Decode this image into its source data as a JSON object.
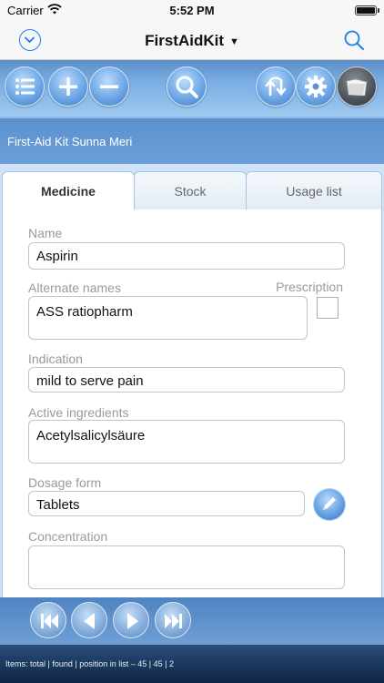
{
  "status_bar": {
    "carrier": "Carrier",
    "time": "5:52 PM"
  },
  "nav": {
    "title": "FirstAidKit",
    "caret": "▼"
  },
  "header": {
    "kit_name": "First-Aid Kit  Sunna Meri"
  },
  "tabs": [
    {
      "label": "Medicine",
      "active": true
    },
    {
      "label": "Stock",
      "active": false
    },
    {
      "label": "Usage list",
      "active": false
    }
  ],
  "form": {
    "name": {
      "label": "Name",
      "value": "Aspirin"
    },
    "alternate_names": {
      "label": "Alternate names",
      "value": "ASS ratiopharm"
    },
    "prescription": {
      "label": "Prescription",
      "checked": false
    },
    "indication": {
      "label": "Indication",
      "value": "mild to serve pain"
    },
    "active_ingredients": {
      "label": "Active ingredients",
      "value": "Acetylsalicylsäure"
    },
    "dosage_form": {
      "label": "Dosage form",
      "value": "Tablets"
    },
    "concentration": {
      "label": "Concentration",
      "value": ""
    }
  },
  "footer": {
    "text": "Items: total | found | position in list  –  45 | 45 | 2"
  },
  "icons": {
    "nav_left": "chevron-down-circle-icon",
    "nav_right": "search-icon",
    "toolbar": [
      "list-icon",
      "plus-icon",
      "minus-icon",
      "search-icon",
      "sort-icon",
      "gear-icon",
      "folder-icon"
    ],
    "bottom": [
      "first-record-icon",
      "previous-record-icon",
      "next-record-icon",
      "last-record-icon"
    ]
  },
  "colors": {
    "accent": "#1a7ff0",
    "toolbar": "#7aaee3",
    "panel": "#cfe3f8"
  }
}
